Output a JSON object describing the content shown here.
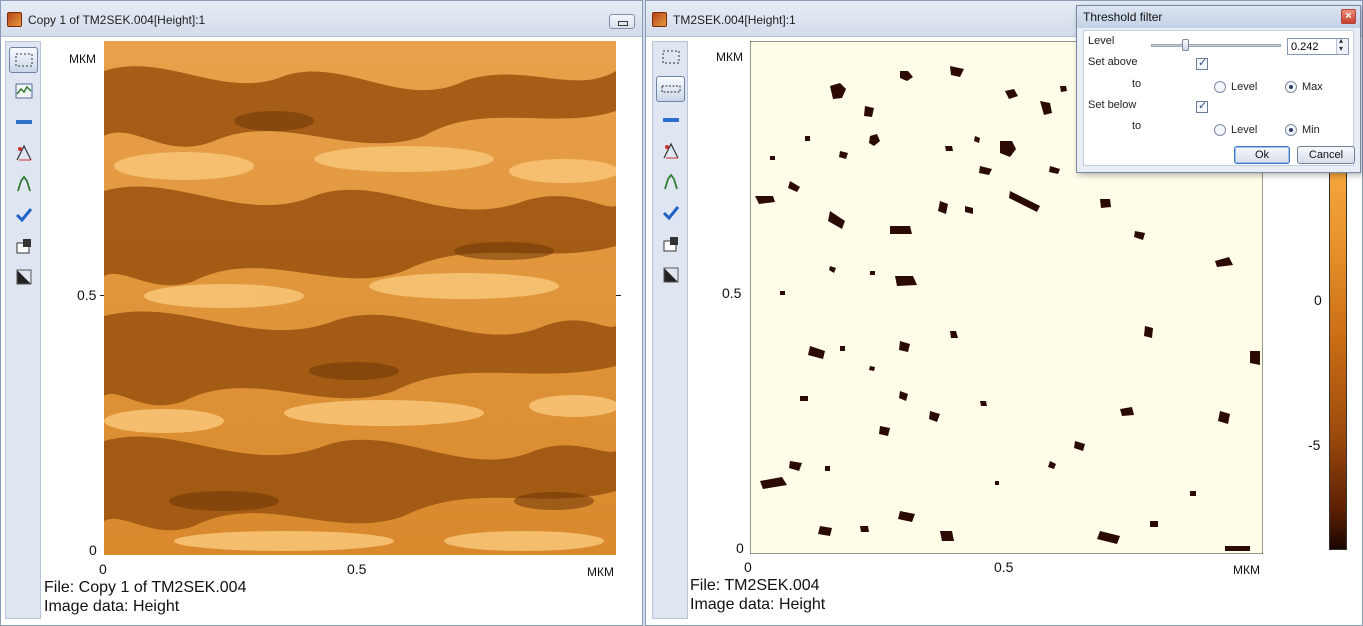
{
  "windows": [
    {
      "title": "Copy 1 of TM2SEK.004[Height]:1",
      "y_axis": {
        "unit": "МКМ",
        "ticks": [
          "0.5",
          "0"
        ]
      },
      "x_axis": {
        "unit": "МКМ",
        "ticks": [
          "0",
          "0.5"
        ]
      },
      "info": {
        "file": "File: Copy 1 of TM2SEK.004",
        "data": "Image data: Height"
      }
    },
    {
      "title": "TM2SEK.004[Height]:1",
      "y_axis": {
        "unit": "МКМ",
        "ticks": [
          "0.5",
          "0"
        ]
      },
      "x_axis": {
        "unit": "МКМ",
        "ticks": [
          "0",
          "0.5"
        ]
      },
      "info": {
        "file": "File: TM2SEK.004",
        "data": "Image data: Height"
      }
    }
  ],
  "colorbar": {
    "ticks": [
      "0",
      "-5"
    ]
  },
  "threshold_dialog": {
    "title": "Threshold filter",
    "level_label": "Level",
    "level_value": "0.242",
    "set_above_label": "Set above",
    "set_above_checked": true,
    "to_label": "to",
    "set_above_options": [
      "Level",
      "Max"
    ],
    "set_above_selected": "Max",
    "set_below_label": "Set below",
    "set_below_checked": true,
    "set_below_options": [
      "Level",
      "Min"
    ],
    "set_below_selected": "Min",
    "ok_label": "Ok",
    "cancel_label": "Cancel"
  },
  "colors": {
    "afm_light": "#f0b35a",
    "afm_mid": "#d88a2a",
    "afm_dark": "#8a4a0c",
    "mask_bg": "#fffde8",
    "mask_blob": "#2a0a02"
  }
}
